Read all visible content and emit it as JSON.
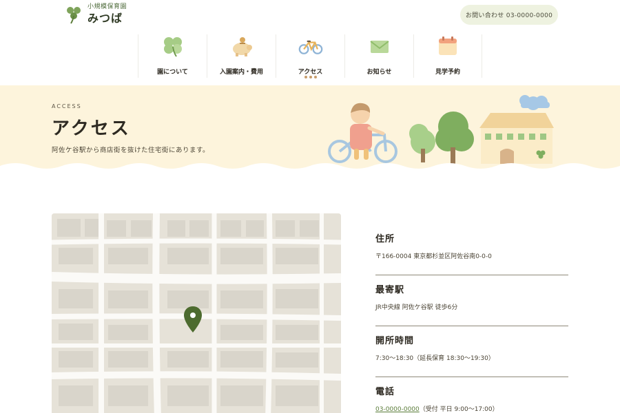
{
  "logo": {
    "sub": "小規模保育園",
    "main": "みつば"
  },
  "contact": {
    "label": "お問い合わせ 03-0000-0000"
  },
  "nav": [
    {
      "label": "園について",
      "icon": "clover-icon"
    },
    {
      "label": "入園案内・費用",
      "icon": "piggy-bank-icon"
    },
    {
      "label": "アクセス",
      "icon": "bicycle-icon",
      "active": true
    },
    {
      "label": "お知らせ",
      "icon": "envelope-icon"
    },
    {
      "label": "見学予約",
      "icon": "calendar-icon"
    }
  ],
  "hero": {
    "eyebrow": "ACCESS",
    "title": "アクセス",
    "lead": "阿佐ケ谷駅から商店街を抜けた住宅街にあります。"
  },
  "info": {
    "address": {
      "heading": "住所",
      "text": "〒166-0004 東京都杉並区阿佐谷南0-0-0"
    },
    "station": {
      "heading": "最寄駅",
      "text": "JR中央線 阿佐ケ谷駅 徒歩6分"
    },
    "hours": {
      "heading": "開所時間",
      "text": "7:30〜18:30（延長保育 18:30〜19:30）"
    },
    "phone": {
      "heading": "電話",
      "number": "03-0000-0000",
      "note": "（受付 平日 9:00〜17:00）"
    }
  },
  "colors": {
    "accent_green": "#5b7d3a",
    "hero_bg": "#fdf4dc",
    "contact_bg": "#eef2e0",
    "pin": "#4d6b2f"
  }
}
